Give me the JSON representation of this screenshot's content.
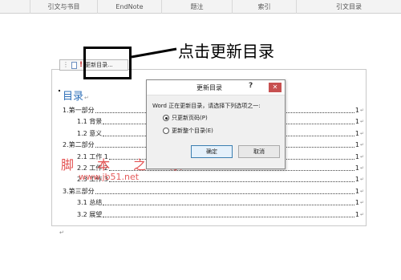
{
  "ribbon": {
    "groups": [
      "",
      "引文与书目",
      "EndNote",
      "题注",
      "索引",
      "引文目录"
    ]
  },
  "toolbar": {
    "update_label": "更新目录..."
  },
  "callout": {
    "text": "点击更新目录"
  },
  "toc": {
    "title": "目录",
    "entries": [
      {
        "text": "1.第一部分",
        "page": "1",
        "level": 1
      },
      {
        "text": "1.1 背景",
        "page": "1",
        "level": 2
      },
      {
        "text": "1.2 意义",
        "page": "1",
        "level": 2
      },
      {
        "text": "2.第二部分",
        "page": "1",
        "level": 1
      },
      {
        "text": "2.1 工作 1",
        "page": "1",
        "level": 2
      },
      {
        "text": "2.2 工作 2",
        "page": "1",
        "level": 2
      },
      {
        "text": "2.3 工作 3",
        "page": "1",
        "level": 2
      },
      {
        "text": "3.第三部分",
        "page": "1",
        "level": 1
      },
      {
        "text": "3.1 总结",
        "page": "1",
        "level": 2
      },
      {
        "text": "3.2 展望",
        "page": "1",
        "level": 2
      }
    ]
  },
  "dialog": {
    "title": "更新目录",
    "help": "?",
    "close": "✕",
    "prompt": "Word 正在更新目录，请选择下列选项之一:",
    "options": [
      {
        "label": "只更新页码(P)",
        "selected": true
      },
      {
        "label": "更新整个目录(E)",
        "selected": false
      }
    ],
    "ok": "确定",
    "cancel": "取消"
  },
  "watermark": {
    "line1": "脚 本 之 家",
    "line2": "www.jb51.net"
  },
  "colors": {
    "accent": "#2e6fb8",
    "watermark": "#e04040",
    "close_button": "#c75050"
  }
}
